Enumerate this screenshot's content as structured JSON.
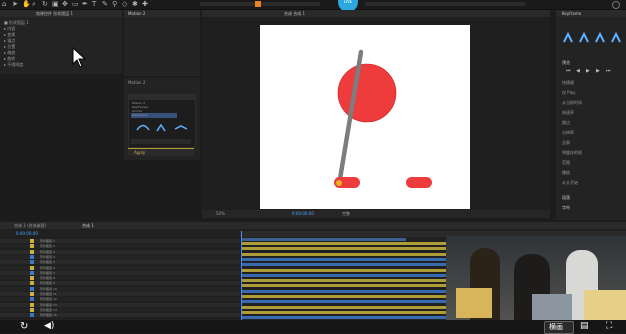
{
  "toolbar": {
    "icons": [
      "home-icon",
      "select-tool-icon",
      "hand-tool-icon",
      "zoom-tool-icon",
      "rotate-tool-icon",
      "camera-tool-icon",
      "pan-behind-icon",
      "rectangle-tool-icon",
      "pen-tool-icon",
      "text-tool-icon",
      "brush-tool-icon",
      "clone-stamp-icon",
      "eraser-icon",
      "roto-brush-icon",
      "puppet-pin-icon"
    ],
    "live_badge": "LIVE"
  },
  "project_panel": {
    "tab_label": "效果控件 形状图层 1",
    "layer_rows": [
      "■ 形状图层 1",
      "  ▸ 内容",
      "  ▸ 变换",
      "  ▸ 锚点",
      "  ▸ 位置",
      "  ▸ 缩放",
      "  ▸ 旋转",
      "  ▸ 不透明度"
    ]
  },
  "effects_panel": {
    "tab_label": "Motion 2",
    "dropdown_label": "Motion 2",
    "list_label": "效果预设",
    "list_items": [
      "Motion 2",
      "Keyframes",
      "Anchor",
      "Overshoot"
    ],
    "footer_label": "Apply"
  },
  "preview_panel": {
    "tab_label": "合成 合成 1",
    "zoom": "50%",
    "time": "0:00:00:00",
    "quality": "完整"
  },
  "right_panel": {
    "tab_label": "Keyframe",
    "section1": "预览",
    "section2": "段落",
    "section3": "字符",
    "labels": [
      "快捷键",
      "仅 Play",
      "从当前时间",
      "帧速率",
      "跳过",
      "分辨率",
      "全屏",
      "将缓存的帧",
      "范围",
      "播放",
      "从头开始"
    ]
  },
  "timeline": {
    "tab1": "合成 1 (合成嵌套)",
    "tab2": "合成 1",
    "timecode": "0:00:00:00",
    "layer_names": [
      "形状图层 1",
      "形状图层 2",
      "形状图层 3",
      "形状图层 4",
      "形状图层 5",
      "形状图层 6",
      "形状图层 7",
      "形状图层 8",
      "形状图层 9",
      "形状图层 10",
      "形状图层 11",
      "形状图层 12",
      "形状图层 13",
      "形状图层 14",
      "形状图层 15"
    ]
  },
  "player": {
    "caption_button": "横画",
    "icons": [
      "replay-icon",
      "volume-icon",
      "subtitle-icon",
      "fullscreen-icon"
    ]
  }
}
